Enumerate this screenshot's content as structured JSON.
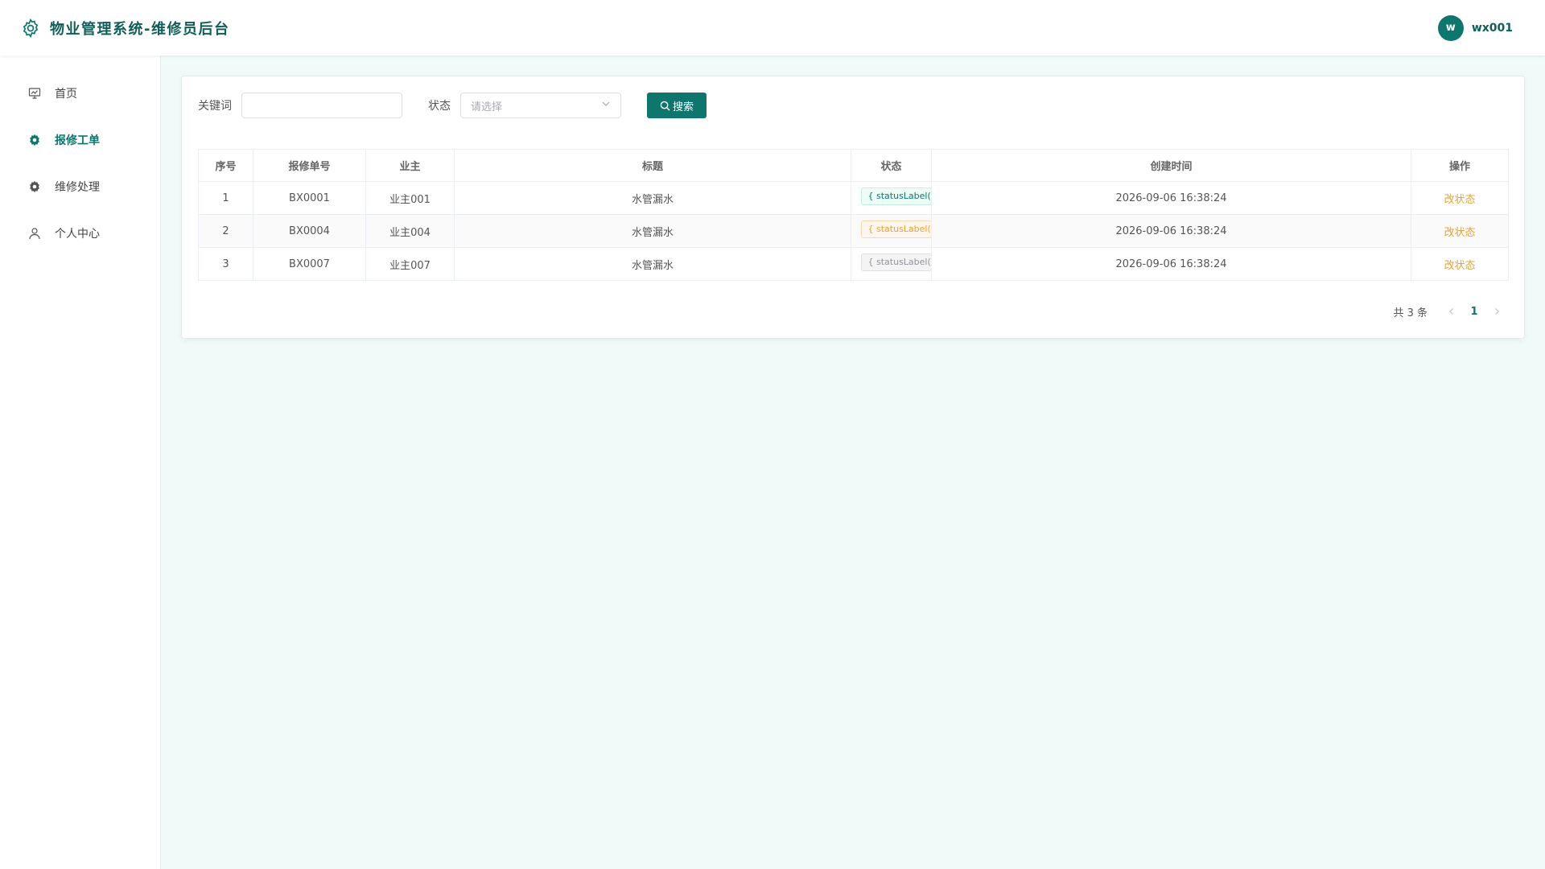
{
  "app": {
    "title": "物业管理系统-维修员后台"
  },
  "user": {
    "avatar_letter": "w",
    "name": "wx001"
  },
  "sidebar": {
    "items": [
      {
        "label": "首页",
        "icon": "dashboard-icon",
        "active": false
      },
      {
        "label": "报修工单",
        "icon": "gear-icon",
        "active": true
      },
      {
        "label": "维修处理",
        "icon": "gear-icon",
        "active": false
      },
      {
        "label": "个人中心",
        "icon": "user-icon",
        "active": false
      }
    ]
  },
  "filters": {
    "keyword_label": "关键词",
    "keyword_value": "",
    "status_label": "状态",
    "status_placeholder": "请选择",
    "search_button": "搜索"
  },
  "table": {
    "headers": [
      "序号",
      "报修单号",
      "业主",
      "标题",
      "状态",
      "创建时间",
      "操作"
    ],
    "rows": [
      {
        "index": "1",
        "order_no": "BX0001",
        "owner": "业主001",
        "title": "水管漏水",
        "status": "{ statusLabel(r",
        "status_color": "green",
        "created": "2026-09-06 16:38:24",
        "action": "改状态"
      },
      {
        "index": "2",
        "order_no": "BX0004",
        "owner": "业主004",
        "title": "水管漏水",
        "status": "{ statusLabel(r",
        "status_color": "orange",
        "created": "2026-09-06 16:38:24",
        "action": "改状态"
      },
      {
        "index": "3",
        "order_no": "BX0007",
        "owner": "业主007",
        "title": "水管漏水",
        "status": "{ statusLabel(r",
        "status_color": "grey",
        "created": "2026-09-06 16:38:24",
        "action": "改状态"
      }
    ]
  },
  "pagination": {
    "total_text": "共 3 条",
    "current_page": "1"
  },
  "colors": {
    "primary": "#0f766e",
    "accent": "#e6a23c",
    "background": "#f0faf8"
  }
}
